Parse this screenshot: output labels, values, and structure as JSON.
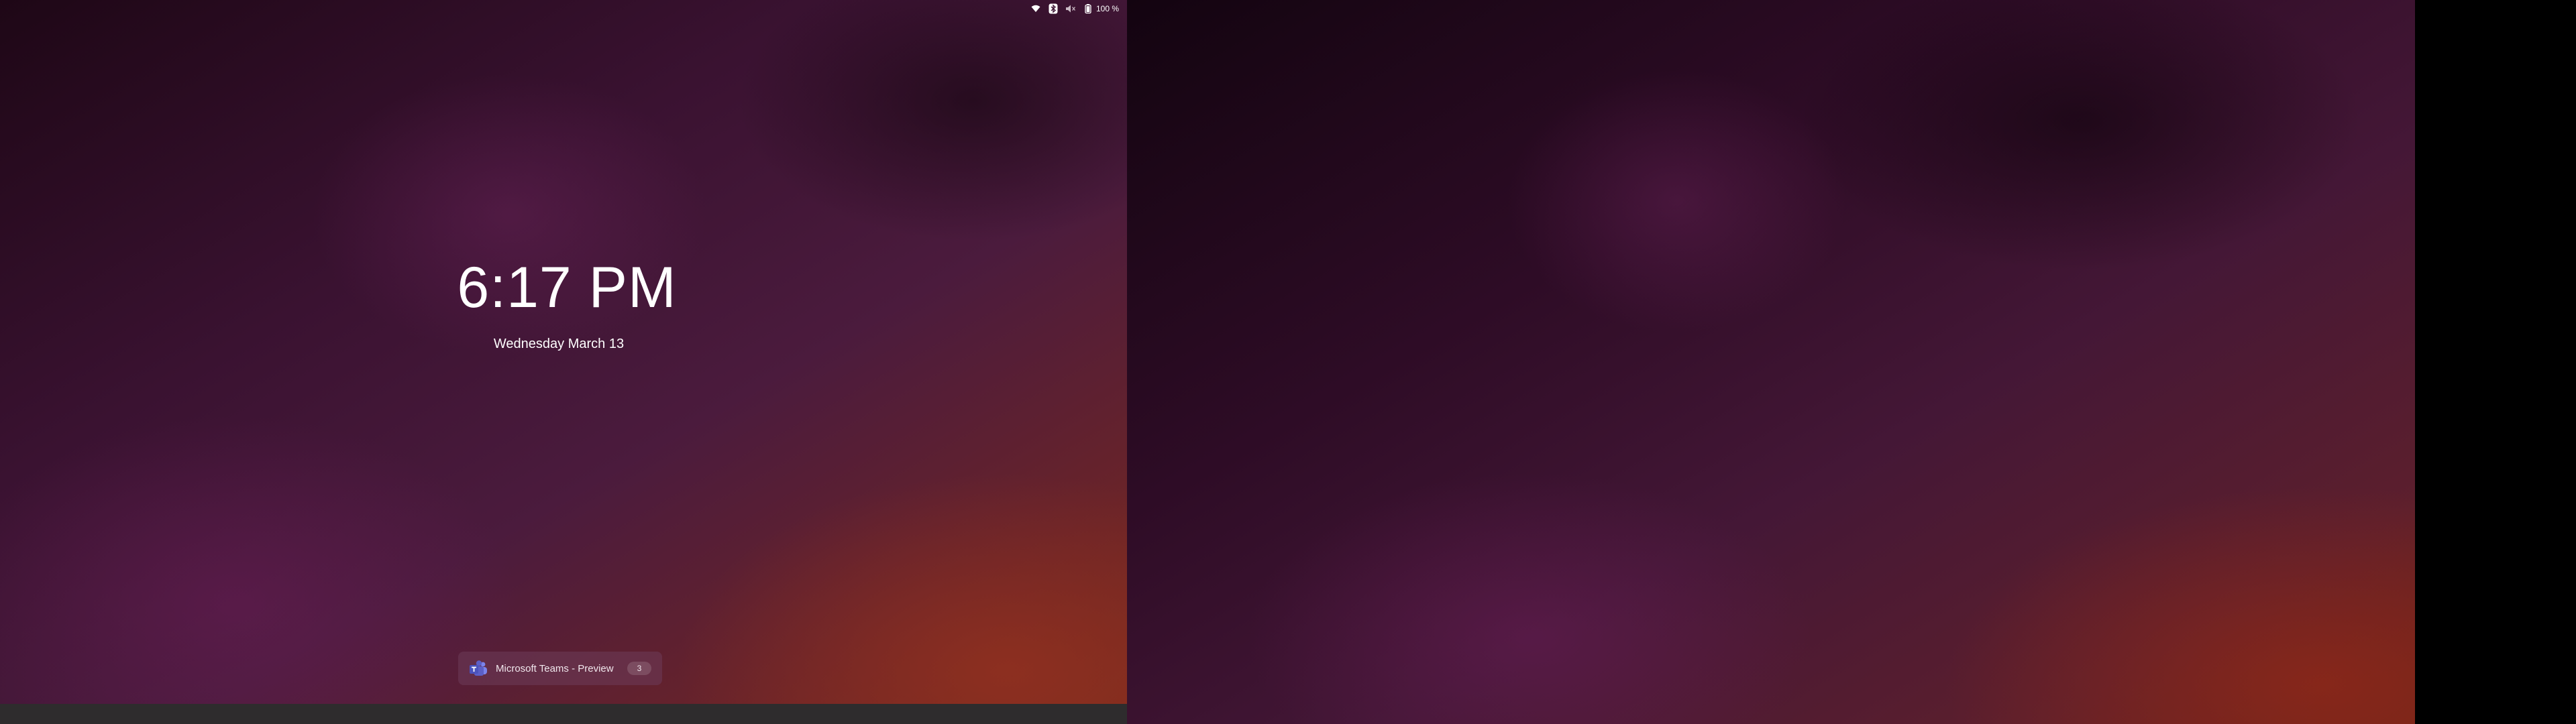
{
  "status_bar": {
    "battery_text": "100 %",
    "icons": [
      "wifi-icon",
      "bluetooth-icon",
      "volume-muted-icon",
      "battery-icon"
    ]
  },
  "lock_screen": {
    "time": "6:17 PM",
    "date": "Wednesday March 13"
  },
  "notification": {
    "app_name": "Microsoft Teams - Preview",
    "count": "3",
    "icon": "teams-icon"
  },
  "colors": {
    "wallpaper_dark": "#1e0716",
    "wallpaper_purple": "#4b1b3d",
    "wallpaper_orange": "#7a2a1e",
    "teams_purple": "#5b5fc7",
    "bottom_strip": "#2e2c2d"
  }
}
